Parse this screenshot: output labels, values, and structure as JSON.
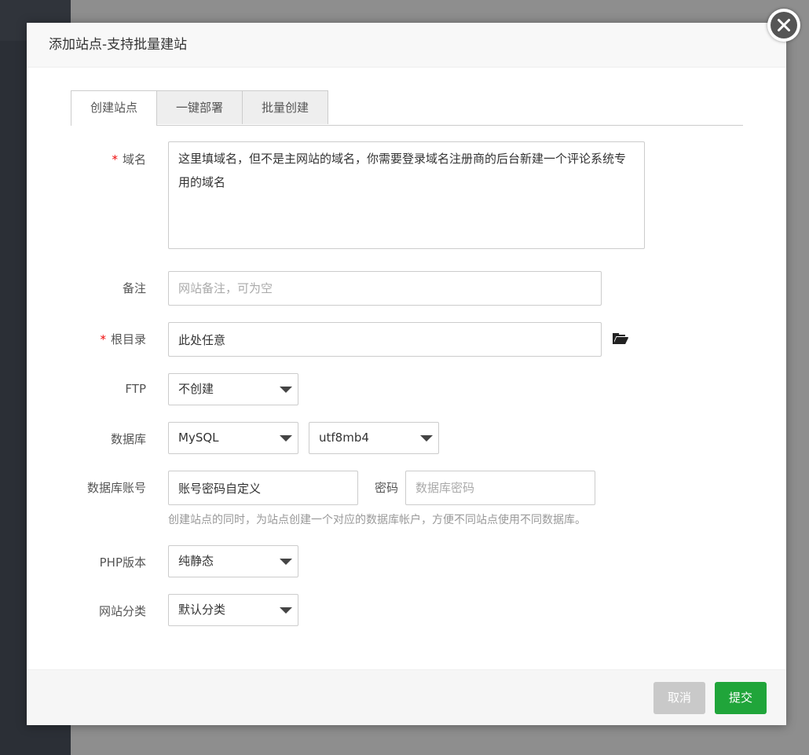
{
  "dialog": {
    "title": "添加站点-支持批量建站",
    "close_icon": "close-icon"
  },
  "tabs": [
    {
      "label": "创建站点",
      "active": true
    },
    {
      "label": "一键部署",
      "active": false
    },
    {
      "label": "批量创建",
      "active": false
    }
  ],
  "form": {
    "required_mark": "*",
    "domain": {
      "label": "域名",
      "value": "这里填域名，但不是主网站的域名，你需要登录域名注册商的后台新建一个评论系统专用的域名"
    },
    "remark": {
      "label": "备注",
      "placeholder": "网站备注，可为空",
      "value": ""
    },
    "root_dir": {
      "label": "根目录",
      "value": "此处任意",
      "icon": "folder-open-icon"
    },
    "ftp": {
      "label": "FTP",
      "selected": "不创建"
    },
    "database": {
      "label": "数据库",
      "type_selected": "MySQL",
      "charset_selected": "utf8mb4"
    },
    "db_account": {
      "label": "数据库账号",
      "value": "账号密码自定义",
      "password_label": "密码",
      "password_placeholder": "数据库密码",
      "hint": "创建站点的同时，为站点创建一个对应的数据库帐户，方便不同站点使用不同数据库。"
    },
    "php": {
      "label": "PHP版本",
      "selected": "纯静态"
    },
    "category": {
      "label": "网站分类",
      "selected": "默认分类"
    }
  },
  "footer": {
    "cancel_label": "取消",
    "submit_label": "提交"
  },
  "colors": {
    "accent_green": "#20a53a",
    "required_red": "#ef0808",
    "sidebar": "#2b2f36"
  }
}
